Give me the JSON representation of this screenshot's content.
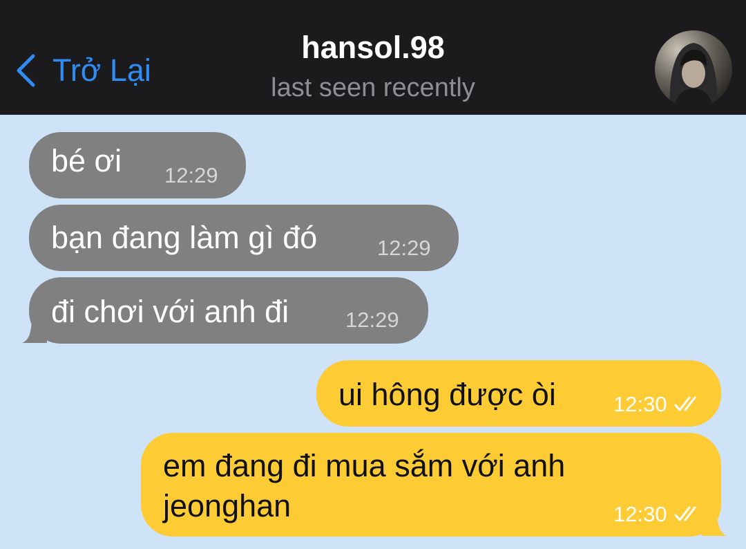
{
  "header": {
    "back_label": "Trở Lại",
    "title": "hansol.98",
    "status": "last seen recently",
    "avatar_icon": "contact-avatar-photo"
  },
  "messages": [
    {
      "direction": "incoming",
      "text": "bé ơi",
      "time": "12:29"
    },
    {
      "direction": "incoming",
      "text": "bạn đang làm gì đó",
      "time": "12:29"
    },
    {
      "direction": "incoming",
      "text": "đi chơi với anh đi",
      "time": "12:29"
    },
    {
      "direction": "outgoing",
      "text": "ui hông được òi",
      "time": "12:30",
      "status_icon": "double-check-icon"
    },
    {
      "direction": "outgoing",
      "text_line1": "em đang đi mua sắm với anh",
      "text_line2": "jeonghan",
      "time": "12:30",
      "status_icon": "double-check-icon"
    }
  ],
  "colors": {
    "header_bg": "#1b1b1d",
    "accent_blue": "#2f8cf2",
    "chat_bg": "#cfe3f8",
    "incoming_bubble": "#808080",
    "outgoing_bubble": "#fdcb34"
  }
}
